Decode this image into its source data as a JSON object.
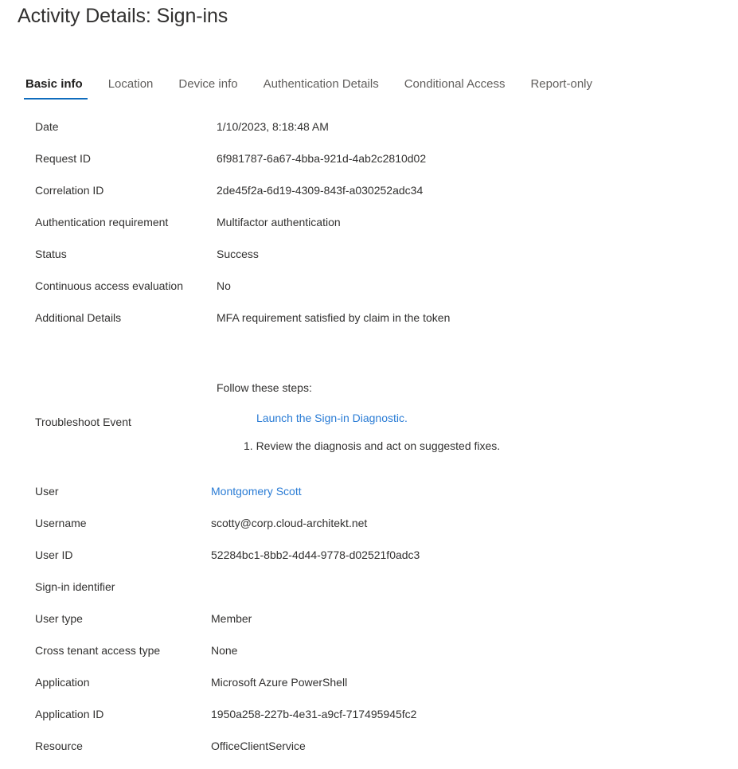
{
  "header": {
    "title": "Activity Details: Sign-ins"
  },
  "tabs": [
    {
      "label": "Basic info",
      "active": true
    },
    {
      "label": "Location",
      "active": false
    },
    {
      "label": "Device info",
      "active": false
    },
    {
      "label": "Authentication Details",
      "active": false
    },
    {
      "label": "Conditional Access",
      "active": false
    },
    {
      "label": "Report-only",
      "active": false
    }
  ],
  "basic_info": {
    "rows_top": [
      {
        "label": "Date",
        "value": "1/10/2023, 8:18:48 AM"
      },
      {
        "label": "Request ID",
        "value": "6f981787-6a67-4bba-921d-4ab2c2810d02"
      },
      {
        "label": "Correlation ID",
        "value": "2de45f2a-6d19-4309-843f-a030252adc34"
      },
      {
        "label": "Authentication requirement",
        "value": "Multifactor authentication"
      },
      {
        "label": "Status",
        "value": "Success"
      },
      {
        "label": "Continuous access evaluation",
        "value": "No"
      },
      {
        "label": "Additional Details",
        "value": "MFA requirement satisfied by claim in the token"
      }
    ],
    "troubleshoot": {
      "label": "Troubleshoot Event",
      "intro": "Follow these steps:",
      "link": "Launch the Sign-in Diagnostic.",
      "step": "1. Review the diagnosis and act on suggested fixes."
    },
    "rows_user": [
      {
        "label": "User",
        "value": "Montgomery Scott",
        "link": true
      },
      {
        "label": "Username",
        "value": "scotty@corp.cloud-architekt.net",
        "link": false
      },
      {
        "label": "User ID",
        "value": "52284bc1-8bb2-4d44-9778-d02521f0adc3",
        "link": false
      },
      {
        "label": "Sign-in identifier",
        "value": "",
        "link": false
      }
    ],
    "rows_app": [
      {
        "label": "User type",
        "value": "Member"
      },
      {
        "label": "Cross tenant access type",
        "value": "None"
      },
      {
        "label": "Application",
        "value": "Microsoft Azure PowerShell"
      },
      {
        "label": "Application ID",
        "value": "1950a258-227b-4e31-a9cf-717495945fc2"
      },
      {
        "label": "Resource",
        "value": "OfficeClientService"
      }
    ]
  },
  "colors": {
    "link": "#2a7cd5",
    "tab_active_underline": "#0f6cbd",
    "text": "#323130",
    "text_muted": "#605e5c"
  }
}
